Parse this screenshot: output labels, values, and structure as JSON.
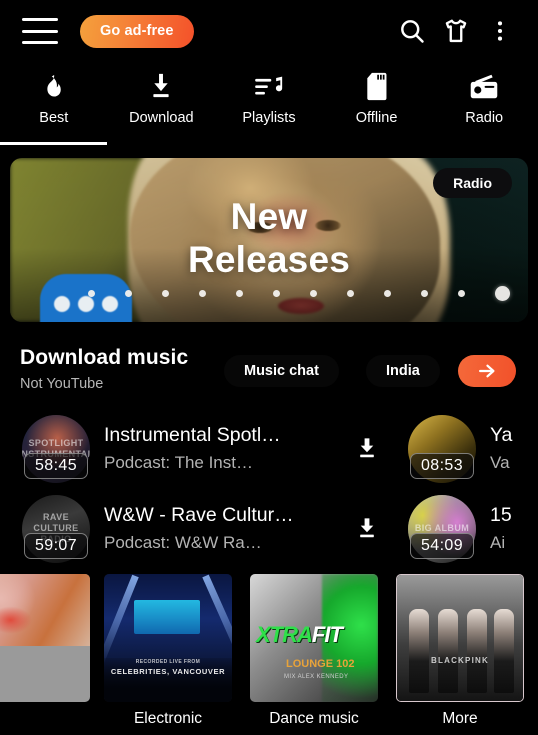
{
  "appbar": {
    "menu_icon": "hamburger-menu-icon",
    "ad_free_label": "Go ad-free",
    "search_icon": "search-icon",
    "merch_icon": "t-shirt-icon",
    "overflow_icon": "three-dot-menu-icon"
  },
  "tabs": {
    "active_index": 0,
    "items": [
      {
        "label": "Best",
        "icon": "flame-icon"
      },
      {
        "label": "Download",
        "icon": "download-icon"
      },
      {
        "label": "Playlists",
        "icon": "playlist-music-icon"
      },
      {
        "label": "Offline",
        "icon": "sd-card-icon"
      },
      {
        "label": "Radio",
        "icon": "radio-icon"
      }
    ]
  },
  "hero": {
    "title_line1": "New",
    "title_line2": "Releases",
    "badge_label": "Radio",
    "dots_total": 12,
    "dots_active_index": 11,
    "overlay_icon": "three-dots-loading-icon"
  },
  "download_section": {
    "title": "Download music",
    "subtitle": "Not YouTube",
    "chip_music_chat": "Music chat",
    "chip_region": "India",
    "arrow_icon": "arrow-right-icon"
  },
  "media_rows": [
    {
      "left": {
        "title": "Instrumental Spotl…",
        "subtitle": "Podcast: The Inst…",
        "duration": "58:45",
        "art_text": "SPOTLIGHT INSTRUMENTAL",
        "download_icon": "download-icon"
      },
      "right": {
        "title": "Ya",
        "subtitle": "Va",
        "duration": "08:53",
        "art_text": ""
      }
    },
    {
      "left": {
        "title": "W&W - Rave Cultur…",
        "subtitle": "Podcast: W&W Ra…",
        "duration": "59:07",
        "art_text": "RAVE CULTURE RADIO",
        "download_icon": "download-icon"
      },
      "right": {
        "title": "15",
        "subtitle": "Ai",
        "duration": "54:09",
        "art_text": "BIG ALBUM"
      }
    }
  ],
  "cards": [
    {
      "label": "",
      "art": "partial-loading-thumbnail"
    },
    {
      "label": "Electronic",
      "art": "concert-stage-celebrities-vancouver",
      "art_caption": "CELEBRITIES, VANCOUVER",
      "art_caption_small": "RECORDED LIVE FROM"
    },
    {
      "label": "Dance music",
      "art": "xtra-fit-lounge-102",
      "art_title_a": "XTRA",
      "art_title_b": "FIT",
      "art_sub_a": "LOUNGE",
      "art_sub_b": "102",
      "art_sub_small": "MIX ALEX KENNEDY"
    },
    {
      "label": "More",
      "art": "blackpink-group-photo",
      "art_caption": "BLACKPINK"
    }
  ],
  "colors": {
    "background": "#000000",
    "accent_orange": "#f4512a",
    "accent_amber": "#f4a13c",
    "accent_purple": "#9b63d8",
    "text_primary": "#ffffff",
    "text_secondary": "#b3b3b3"
  }
}
